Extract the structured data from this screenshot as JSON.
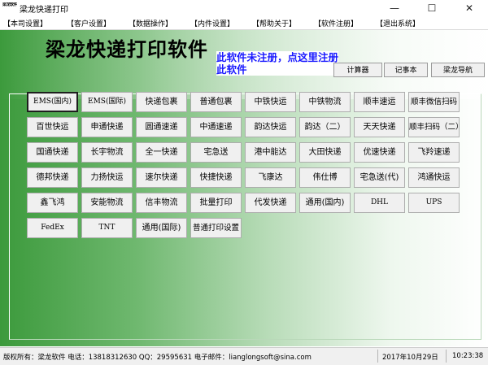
{
  "window": {
    "app_icon_text": "梁龙软件",
    "title": "梁龙快递打印",
    "minimize_glyph": "—",
    "maximize_glyph": "☐",
    "close_glyph": "✕"
  },
  "menu": {
    "items": [
      "【本司设置】",
      "【客户设置】",
      "【数据操作】",
      "【内件设置】",
      "【帮助关于】",
      "【软件注册】",
      "【退出系统】"
    ]
  },
  "header": {
    "heading": "梁龙快递打印软件",
    "register_notice": "此软件未注册，点这里注册此软件",
    "buttons": [
      "计算器",
      "记事本",
      "梁龙导航"
    ]
  },
  "courier_buttons": [
    [
      "EMS(国内)",
      "EMS(国际)",
      "快递包裹",
      "普通包裹",
      "中铁快运",
      "中铁物流",
      "顺丰速运",
      "顺丰微信扫码"
    ],
    [
      "百世快运",
      "申通快递",
      "圆通速递",
      "中通速递",
      "韵达快运",
      "韵达（二）",
      "天天快递",
      "顺丰扫码（二）"
    ],
    [
      "国通快递",
      "长宇物流",
      "全一快递",
      "宅急送",
      "港中能达",
      "大田快递",
      "优速快递",
      "飞羚速递"
    ],
    [
      "德邦快递",
      "力扬快运",
      "速尔快递",
      "快捷快递",
      "飞康达",
      "伟仕博",
      "宅急送(代)",
      "鸿通快运"
    ],
    [
      "鑫飞鸿",
      "安能物流",
      "信丰物流",
      "批量打印",
      "代发快递",
      "通用(国内)",
      "DHL",
      "UPS"
    ],
    [
      "FedEx",
      "TNT",
      "通用(国际)",
      "普通打印设置"
    ]
  ],
  "status": {
    "copyright": "版权所有：梁龙软件 电话：13818312630 QQ：29595631 电子邮件：lianglongsoft@sina.com",
    "date": "2017年10月29日",
    "time": "10:23:38"
  }
}
